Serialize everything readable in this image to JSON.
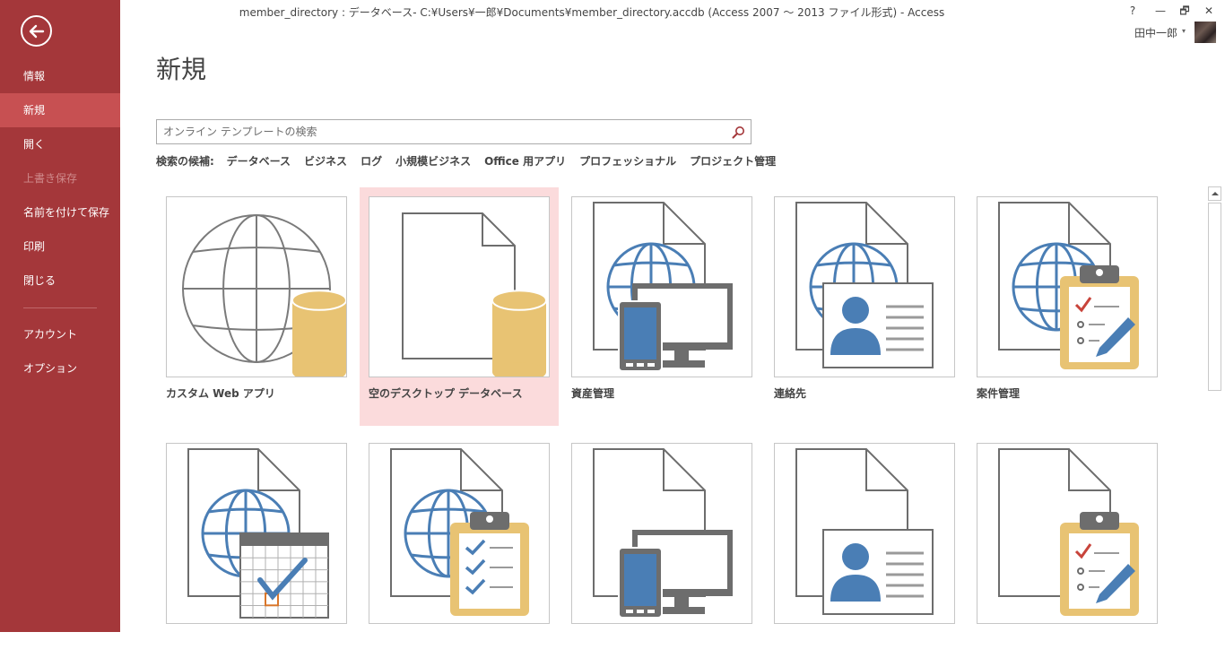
{
  "window": {
    "title": "member_directory : データベース- C:¥Users¥一郎¥Documents¥member_directory.accdb (Access 2007 ～ 2013 ファイル形式) - Access",
    "help": "?",
    "minimize": "—",
    "restore": "🗗",
    "close": "✕",
    "user_name": "田中一郎",
    "user_caret": "▾"
  },
  "nav": {
    "back_icon": "back-arrow-icon",
    "items": [
      {
        "label": "情報",
        "state": "normal"
      },
      {
        "label": "新規",
        "state": "active"
      },
      {
        "label": "開く",
        "state": "normal"
      },
      {
        "label": "上書き保存",
        "state": "disabled"
      },
      {
        "label": "名前を付けて保存",
        "state": "normal"
      },
      {
        "label": "印刷",
        "state": "normal"
      },
      {
        "label": "閉じる",
        "state": "normal"
      },
      {
        "label": "アカウント",
        "state": "normal"
      },
      {
        "label": "オプション",
        "state": "normal"
      }
    ]
  },
  "main": {
    "title": "新規",
    "search": {
      "placeholder": "オンライン テンプレートの検索",
      "icon": "search-icon"
    },
    "suggestions": {
      "label": "検索の候補:",
      "items": [
        "データベース",
        "ビジネス",
        "ログ",
        "小規模ビジネス",
        "Office 用アプリ",
        "プロフェッショナル",
        "プロジェクト管理"
      ]
    },
    "templates": [
      {
        "caption": "カスタム Web アプリ",
        "icon": "globe-database-icon"
      },
      {
        "caption": "空のデスクトップ データベース",
        "icon": "blank-document-database-icon",
        "selected": true
      },
      {
        "caption": "資産管理",
        "icon": "web-devices-icon"
      },
      {
        "caption": "連絡先",
        "icon": "web-contact-card-icon"
      },
      {
        "caption": "案件管理",
        "icon": "web-clipboard-pen-icon"
      },
      {
        "caption": "",
        "icon": "web-calendar-check-icon"
      },
      {
        "caption": "",
        "icon": "web-clipboard-checklist-icon"
      },
      {
        "caption": "",
        "icon": "devices-icon"
      },
      {
        "caption": "",
        "icon": "contact-card-icon"
      },
      {
        "caption": "",
        "icon": "clipboard-pen-icon"
      }
    ]
  },
  "colors": {
    "nav_bg": "#a4373a",
    "nav_active": "#c75052",
    "selected_tile": "#fbdbdc",
    "icon_blue": "#4a7eb5",
    "icon_gray": "#6d6d6d",
    "icon_gold": "#e8c373"
  }
}
